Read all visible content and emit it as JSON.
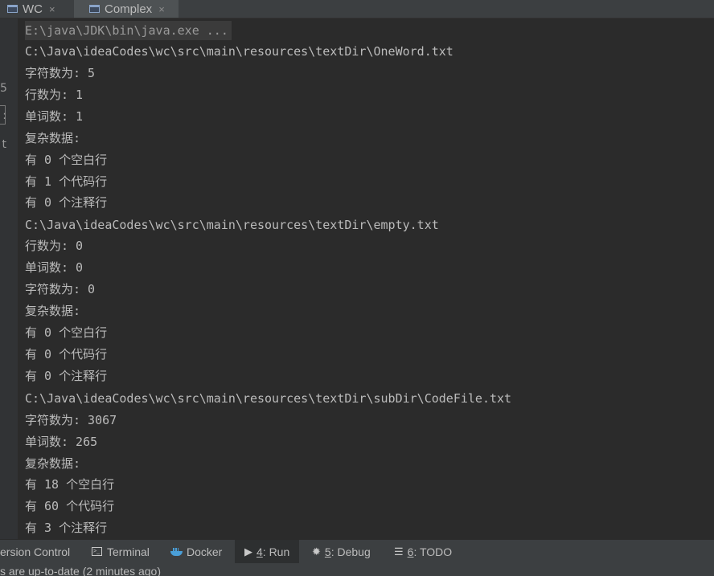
{
  "tabs": [
    {
      "label": "WC",
      "close": "×",
      "icon": "window-icon"
    },
    {
      "label": "Complex",
      "close": "×",
      "icon": "window-icon"
    }
  ],
  "gutter": {
    "top_glyph": "5",
    "mid_glyph": ":",
    "bottom_glyph": "t"
  },
  "console": {
    "lines": [
      "E:\\java\\JDK\\bin\\java.exe ...",
      "C:\\Java\\ideaCodes\\wc\\src\\main\\resources\\textDir\\OneWord.txt",
      "字符数为: 5",
      "行数为: 1",
      "单词数: 1",
      "复杂数据:",
      "有 0 个空白行",
      "有 1 个代码行",
      "有 0 个注释行",
      "C:\\Java\\ideaCodes\\wc\\src\\main\\resources\\textDir\\empty.txt",
      "行数为: 0",
      "单词数: 0",
      "字符数为: 0",
      "复杂数据:",
      "有 0 个空白行",
      "有 0 个代码行",
      "有 0 个注释行",
      "C:\\Java\\ideaCodes\\wc\\src\\main\\resources\\textDir\\subDir\\CodeFile.txt",
      "字符数为: 3067",
      "单词数: 265",
      "复杂数据:",
      "有 18 个空白行",
      "有 60 个代码行",
      "有 3 个注释行"
    ]
  },
  "toolwindows": {
    "version_control": {
      "label": "ersion Control"
    },
    "terminal": {
      "label": "Terminal",
      "icon": "terminal-icon"
    },
    "docker": {
      "label": "Docker",
      "icon": "docker-icon"
    },
    "run": {
      "mnemonic": "4",
      "label": ": Run",
      "icon": "play-icon",
      "glyph": "▶"
    },
    "debug": {
      "mnemonic": "5",
      "label": ": Debug",
      "icon": "bug-icon",
      "glyph": "✹"
    },
    "todo": {
      "mnemonic": "6",
      "label": ": TODO",
      "icon": "list-icon",
      "glyph": "☰"
    }
  },
  "status": {
    "text": "s are up-to-date (2 minutes ago)"
  },
  "colors": {
    "background": "#2b2b2b",
    "text": "#bbbbbb",
    "panel": "#3c3f41"
  }
}
